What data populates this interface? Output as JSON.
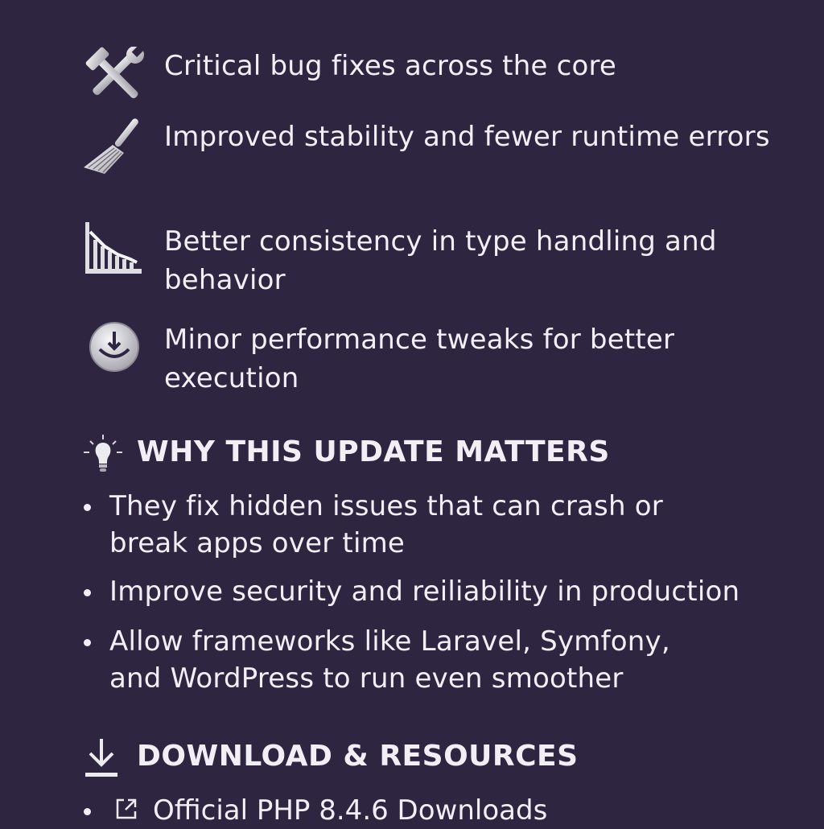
{
  "features": [
    {
      "icon": "hammer-wrench-icon",
      "text": "Critical bug fixes across the core"
    },
    {
      "icon": "broom-icon",
      "text": "Improved stability and fewer runtime errors"
    },
    {
      "icon": "declining-chart-icon",
      "text": "Better consistency in type handling and behavior"
    },
    {
      "icon": "download-circle-icon",
      "text": "Minor performance tweaks for better execution"
    }
  ],
  "why": {
    "icon": "lightbulb-icon",
    "title": "WHY THIS UPDATE MATTERS",
    "bullets": [
      "They fix hidden issues that can crash or break apps over time",
      "Improve security and reiliability in production",
      "Allow frameworks like Laravel, Symfony, and WordPress to run even smoother"
    ]
  },
  "resources": {
    "icon": "download-arrow-icon",
    "title": "DOWNLOAD & RESOURCES",
    "items": [
      {
        "icon": "external-link-icon",
        "label": "Official PHP 8.4.6 Downloads"
      }
    ]
  }
}
